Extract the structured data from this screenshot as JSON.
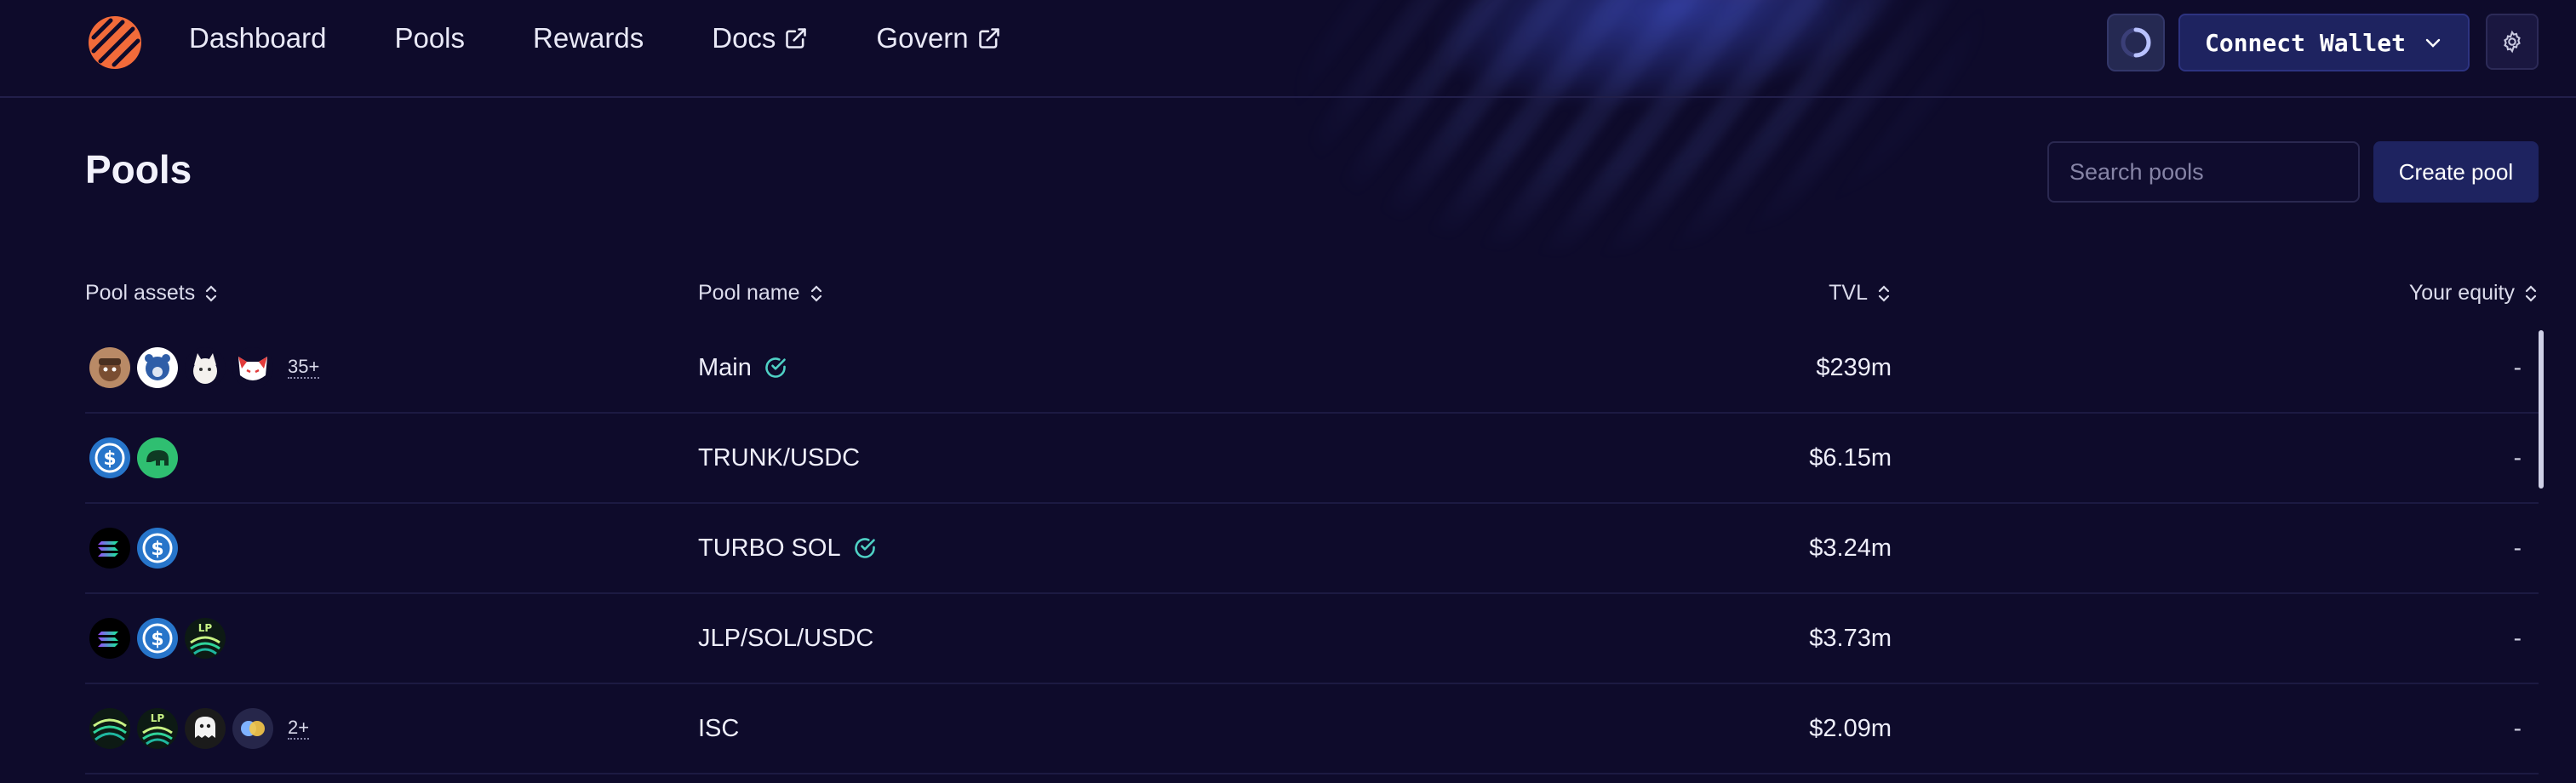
{
  "nav": {
    "links": [
      {
        "label": "Dashboard"
      },
      {
        "label": "Pools"
      },
      {
        "label": "Rewards"
      },
      {
        "label": "Docs",
        "icon": "external-link-icon"
      },
      {
        "label": "Govern",
        "icon": "external-link-icon"
      }
    ],
    "connect_label": "Connect Wallet",
    "brand_color": "#f26b3a"
  },
  "page": {
    "title": "Pools",
    "search_placeholder": "Search pools",
    "create_label": "Create pool"
  },
  "table": {
    "columns": [
      "Pool assets",
      "Pool name",
      "TVL",
      "Your equity"
    ],
    "rows": [
      {
        "assets": [
          "mascot-dog-token-icon",
          "bear-token-icon",
          "white-dog-token-icon",
          "fox-mask-token-icon"
        ],
        "more": "35+",
        "name": "Main",
        "verified": true,
        "tvl": "$239m",
        "equity": "-"
      },
      {
        "assets": [
          "usdc-icon",
          "trunk-icon"
        ],
        "more": "",
        "name": "TRUNK/USDC",
        "verified": false,
        "tvl": "$6.15m",
        "equity": "-"
      },
      {
        "assets": [
          "sol-icon",
          "usdc-icon"
        ],
        "more": "",
        "name": "TURBO SOL",
        "verified": true,
        "tvl": "$3.24m",
        "equity": "-"
      },
      {
        "assets": [
          "sol-icon",
          "usdc-icon",
          "jlp-lp-icon"
        ],
        "more": "",
        "name": "JLP/SOL/USDC",
        "verified": false,
        "tvl": "$3.73m",
        "equity": "-"
      },
      {
        "assets": [
          "green-swirl-token-icon",
          "jlp-lp-icon",
          "ghost-token-icon",
          "dual-coin-token-icon"
        ],
        "more": "2+",
        "name": "ISC",
        "verified": false,
        "tvl": "$2.09m",
        "equity": "-"
      }
    ]
  }
}
